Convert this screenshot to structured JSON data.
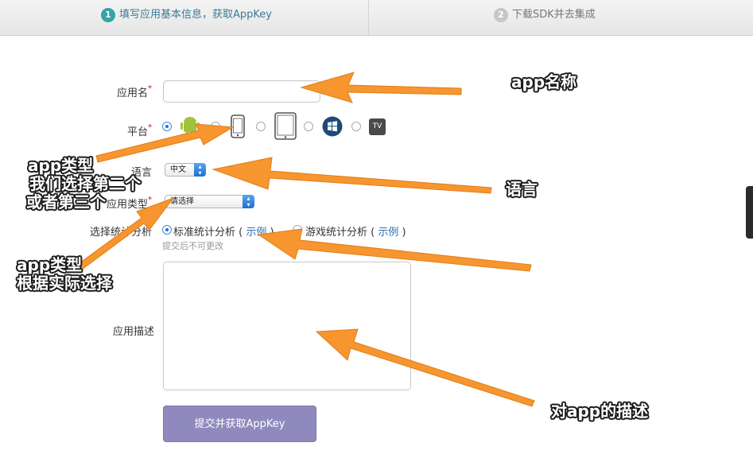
{
  "steps": [
    {
      "num": "1",
      "label": "填写应用基本信息，获取AppKey"
    },
    {
      "num": "2",
      "label": "下载SDK并去集成"
    }
  ],
  "form": {
    "app_name_label": "应用名",
    "platform_label": "平台",
    "language_label": "语言",
    "language_value": "中文",
    "app_type_label": "应用类型",
    "app_type_value": "请选择",
    "stat_type_label": "选择统计分析",
    "stat_option_1": "标准统计分析",
    "stat_option_2": "游戏统计分析",
    "example_link": "示例",
    "stat_hint": "提交后不可更改",
    "desc_label": "应用描述",
    "submit_label": "提交并获取AppKey",
    "required_mark": "*",
    "platforms": [
      "android-icon",
      "phone-icon",
      "tablet-icon",
      "windows-icon",
      "tv-icon"
    ],
    "tv_text": "TV"
  },
  "annotations": {
    "app_name": "app名称",
    "app_type_top_1": "app类型",
    "app_type_top_2": "我们选择第二个",
    "app_type_top_3": "或者第三个",
    "language": "语言",
    "app_type_bottom_1": "app类型",
    "app_type_bottom_2": "根据实际选择",
    "desc": "对app的描述"
  },
  "colors": {
    "arrow": "#f7952e",
    "step_active": "#35a2a5",
    "submit_bg": "#8f89bd",
    "android_green": "#9fc33a"
  }
}
